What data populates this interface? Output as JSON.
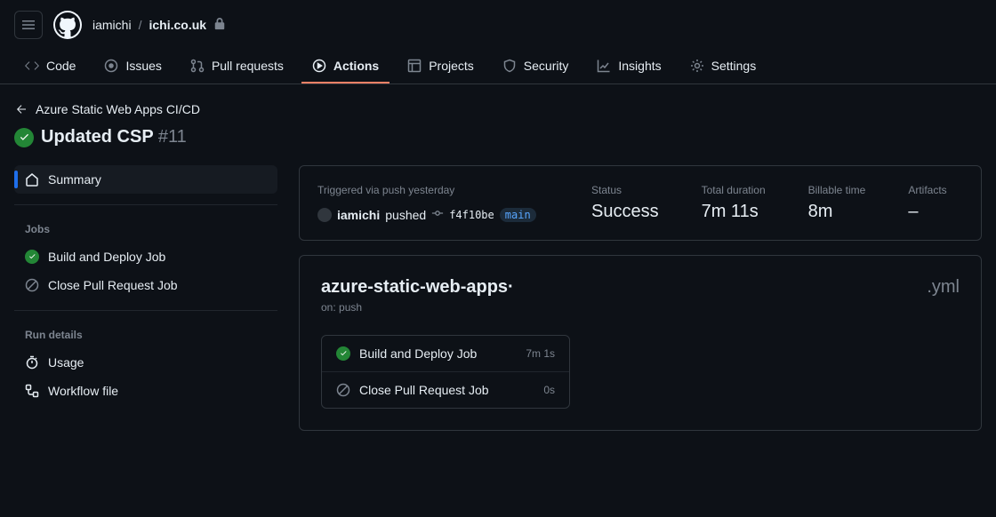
{
  "header": {
    "owner": "iamichi",
    "repo": "ichi.co.uk"
  },
  "nav": {
    "code": "Code",
    "issues": "Issues",
    "pulls": "Pull requests",
    "actions": "Actions",
    "projects": "Projects",
    "security": "Security",
    "insights": "Insights",
    "settings": "Settings"
  },
  "back_link": "Azure Static Web Apps CI/CD",
  "run": {
    "title": "Updated CSP",
    "number": "#11"
  },
  "sidebar": {
    "summary": "Summary",
    "jobs_heading": "Jobs",
    "jobs": [
      {
        "label": "Build and Deploy Job"
      },
      {
        "label": "Close Pull Request Job"
      }
    ],
    "run_details_heading": "Run details",
    "usage": "Usage",
    "workflow_file": "Workflow file"
  },
  "summary": {
    "triggered_label": "Triggered via push yesterday",
    "user": "iamichi",
    "action": "pushed",
    "commit": "f4f10be",
    "branch": "main",
    "status_label": "Status",
    "status_value": "Success",
    "duration_label": "Total duration",
    "duration_value": "7m 11s",
    "billable_label": "Billable time",
    "billable_value": "8m",
    "artifacts_label": "Artifacts",
    "artifacts_value": "–"
  },
  "workflow": {
    "name_prefix": "azure-static-web-apps·",
    "name_ext": ".yml",
    "on": "on: push",
    "jobs": [
      {
        "label": "Build and Deploy Job",
        "duration": "7m 1s"
      },
      {
        "label": "Close Pull Request Job",
        "duration": "0s"
      }
    ]
  }
}
